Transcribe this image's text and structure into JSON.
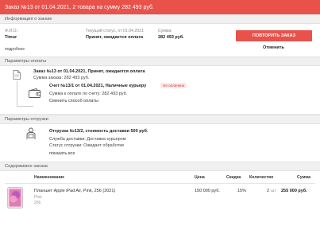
{
  "header": {
    "title": "Заказ №13 от 01.04.2021, 2 товара на сумму 282 493 руб."
  },
  "order_info": {
    "section_title": "Информация о заказе",
    "fio_label": "Ф.И.О.:",
    "fio_value": "Timur",
    "details_link": "подробнее",
    "status_label": "Текущий статус, от 01.04.2021",
    "status_value": "Принят, ожидается оплата",
    "sum_label": "Сумма:",
    "sum_value": "282 493 руб.",
    "repeat_button": "ПОВТОРИТЬ ЗАКАЗ",
    "cancel_link": "Отменить"
  },
  "payment": {
    "section_title": "Параметры оплаты",
    "order_title": "Заказ №13 от 01.04.2021, Принят, ожидается оплата",
    "order_sum": "Сумма заказа: 282 493 руб.",
    "invoice_title": "Счет №13/1 от 01.04.2021, Наличные курьеру",
    "invoice_badge": "Не оплачено",
    "invoice_sum": "Сумма к оплате по счету: 282 493 руб.",
    "change_method": "Сменить способ оплаты"
  },
  "shipping": {
    "section_title": "Параметры отгрузки",
    "title": "Отгрузка №13/2, стоимость доставки 500 руб.",
    "service": "Служба доставки: Доставка курьером",
    "status": "Статус отгрузки: Ожидает обработки",
    "show_all": "показать все"
  },
  "contents": {
    "section_title": "Содержимое заказа",
    "columns": {
      "name": "Наименование",
      "price": "Цена",
      "discount": "Скидка",
      "quantity": "Количество",
      "sum": "Сумма"
    },
    "items": [
      {
        "name": "Планшет Apple iPad Air, Pink, 256 (2021)",
        "color": "Pink",
        "size": "256",
        "price": "150 000 руб.",
        "discount": "15%",
        "quantity": "2",
        "unit": "шт",
        "sum": "255 000 руб."
      }
    ]
  },
  "colors": {
    "accent": "#e8524b",
    "badge_bg": "#fde7e7",
    "section_bg": "#f0f0f0"
  },
  "icons": {
    "order": "document-icon",
    "invoice": "wallet-icon",
    "shipping": "courier-icon",
    "product": "tablet-icon"
  }
}
